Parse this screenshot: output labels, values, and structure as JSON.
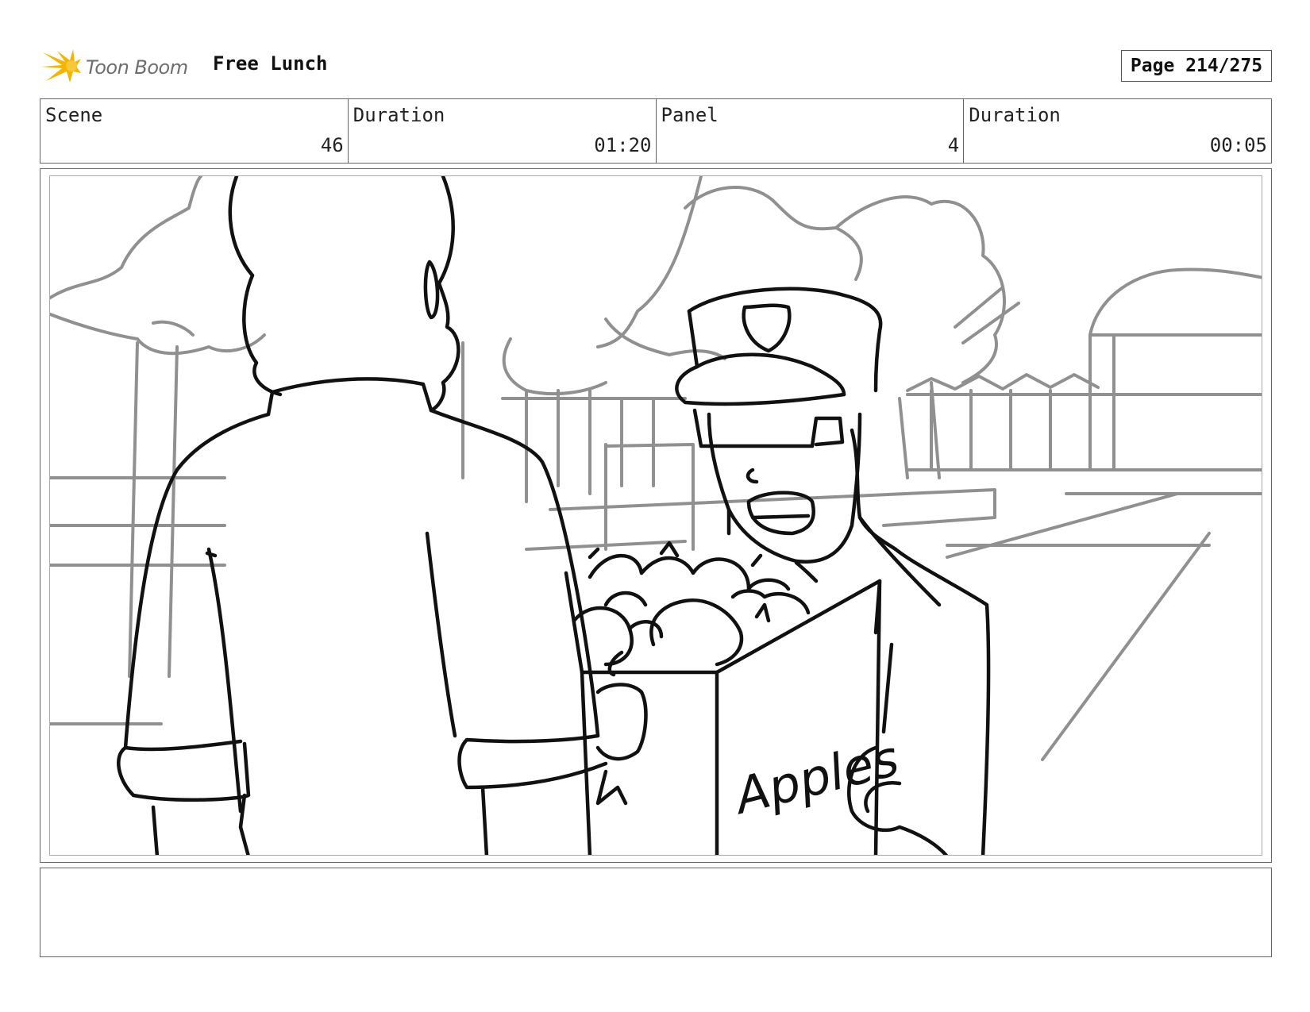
{
  "header": {
    "logo_text": "Toon Boom",
    "project_title": "Free Lunch",
    "page_label": "Page 214/275"
  },
  "info": {
    "scene_label": "Scene",
    "scene_value": "46",
    "scene_duration_label": "Duration",
    "scene_duration_value": "01:20",
    "panel_label": "Panel",
    "panel_value": "4",
    "panel_duration_label": "Duration",
    "panel_duration_value": "00:05"
  },
  "panel": {
    "box_text": "Apples"
  },
  "notes": {
    "text": ""
  },
  "colors": {
    "logo_accent": "#f5b400",
    "background_lines": "#909090",
    "ink": "#111111"
  }
}
